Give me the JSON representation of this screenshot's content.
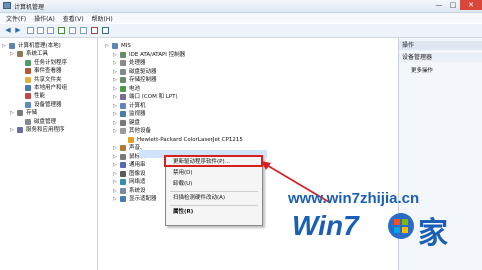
{
  "window": {
    "title": "计算机管理",
    "controls": [
      "—",
      "□",
      "✕"
    ]
  },
  "menu": [
    "文件(F)",
    "操作(A)",
    "查看(V)",
    "帮助(H)"
  ],
  "left_tree": [
    {
      "label": "计算机管理(本地)",
      "depth": 0,
      "icon": "computer-icon"
    },
    {
      "label": "系统工具",
      "depth": 1,
      "icon": "tools-icon"
    },
    {
      "label": "任务计划程序",
      "depth": 2,
      "icon": "clock-icon"
    },
    {
      "label": "事件查看器",
      "depth": 2,
      "icon": "log-icon"
    },
    {
      "label": "共享文件夹",
      "depth": 2,
      "icon": "folder-icon"
    },
    {
      "label": "本地用户和组",
      "depth": 2,
      "icon": "users-icon"
    },
    {
      "label": "性能",
      "depth": 2,
      "icon": "performance-icon"
    },
    {
      "label": "设备管理器",
      "depth": 2,
      "icon": "device-manager-icon"
    },
    {
      "label": "存储",
      "depth": 1,
      "icon": "storage-icon"
    },
    {
      "label": "磁盘管理",
      "depth": 2,
      "icon": "disk-icon"
    },
    {
      "label": "服务和应用程序",
      "depth": 1,
      "icon": "services-icon"
    }
  ],
  "device_tree": [
    {
      "label": "MIS",
      "depth": 0,
      "icon": "computer-icon"
    },
    {
      "label": "IDE ATA/ATAPI 控制器",
      "depth": 1,
      "icon": "controller-icon"
    },
    {
      "label": "处理器",
      "depth": 1,
      "icon": "cpu-icon"
    },
    {
      "label": "磁盘驱动器",
      "depth": 1,
      "icon": "disk-icon"
    },
    {
      "label": "存储控制器",
      "depth": 1,
      "icon": "controller-icon"
    },
    {
      "label": "电池",
      "depth": 1,
      "icon": "battery-icon"
    },
    {
      "label": "端口 (COM 和 LPT)",
      "depth": 1,
      "icon": "port-icon"
    },
    {
      "label": "计算机",
      "depth": 1,
      "icon": "computer-icon"
    },
    {
      "label": "监视器",
      "depth": 1,
      "icon": "monitor-icon"
    },
    {
      "label": "键盘",
      "depth": 1,
      "icon": "keyboard-icon"
    },
    {
      "label": "其他设备",
      "depth": 1,
      "icon": "unknown-device-icon"
    },
    {
      "label": "Hewlett-Packard ColorLaserJet CP1215",
      "depth": 2,
      "icon": "warning-device-icon"
    },
    {
      "label": "声音、",
      "depth": 1,
      "icon": "sound-icon"
    },
    {
      "label": "鼠标和",
      "depth": 1,
      "icon": "mouse-icon"
    },
    {
      "label": "通用串",
      "depth": 1,
      "icon": "usb-icon"
    },
    {
      "label": "图像设",
      "depth": 1,
      "icon": "camera-icon"
    },
    {
      "label": "网络适",
      "depth": 1,
      "icon": "network-icon"
    },
    {
      "label": "系统设",
      "depth": 1,
      "icon": "system-icon"
    },
    {
      "label": "显示适配器",
      "depth": 1,
      "icon": "display-icon"
    }
  ],
  "context_menu": {
    "items": [
      "更新驱动程序软件(P)...",
      "禁用(D)",
      "卸载(U)",
      "扫描检测硬件改动(A)",
      "属性(R)"
    ]
  },
  "right_pane": {
    "header": "操作",
    "section": "设备管理器",
    "more": "更多操作"
  },
  "watermark": {
    "url": "www.win7zhijia.cn",
    "brand": "Win7",
    "brand_suffix": "家"
  },
  "colors": {
    "highlight": "#d42020",
    "watermark_blue": "#1a5fb4",
    "selection": "#cfe3fa"
  }
}
